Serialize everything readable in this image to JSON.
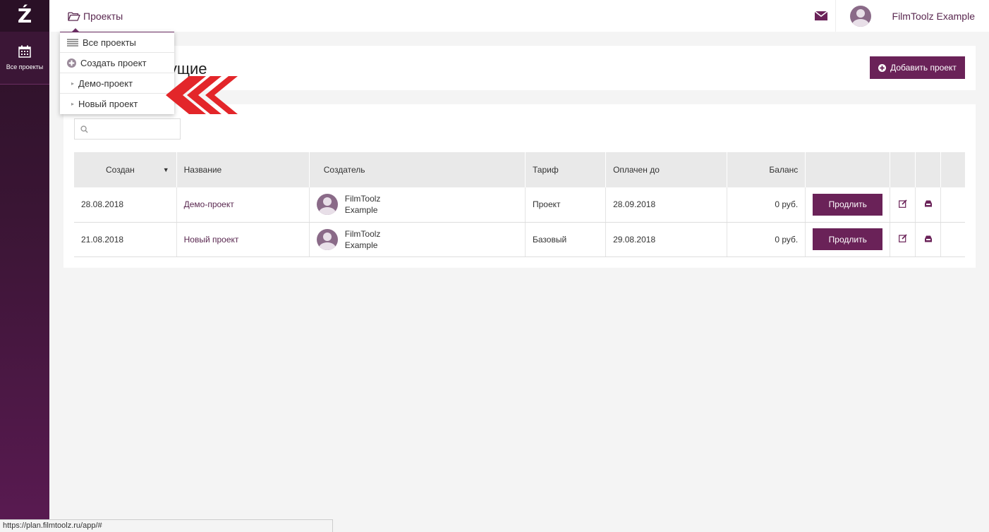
{
  "sidebar": {
    "logo": "Ź",
    "items": [
      {
        "label": "Все проекты",
        "icon": "calendar-icon"
      }
    ]
  },
  "topbar": {
    "projects_label": "Проекты",
    "user_name": "FilmToolz Example"
  },
  "dropdown": {
    "items": [
      {
        "label": "Все проекты",
        "icon": "list-icon"
      },
      {
        "label": "Создать проект",
        "icon": "plus-circle-icon"
      },
      {
        "label": "Демо-проект",
        "icon": "caret-right-icon"
      },
      {
        "label": "Новый проект",
        "icon": "caret-right-icon"
      }
    ]
  },
  "page": {
    "title": "кущие",
    "add_button": "Добавить проект"
  },
  "search": {
    "placeholder": ""
  },
  "table": {
    "headers": [
      "Создан",
      "Название",
      "Создатель",
      "Тариф",
      "Оплачен до",
      "Баланс"
    ],
    "rows": [
      {
        "created": "28.08.2018",
        "name": "Демо-проект",
        "creator_first": "FilmToolz",
        "creator_last": "Example",
        "tariff": "Проект",
        "paid_until": "28.09.2018",
        "balance": "0 руб.",
        "action": "Продлить"
      },
      {
        "created": "21.08.2018",
        "name": "Новый проект",
        "creator_first": "FilmToolz",
        "creator_last": "Example",
        "tariff": "Базовый",
        "paid_until": "29.08.2018",
        "balance": "0 руб.",
        "action": "Продлить"
      }
    ]
  },
  "statusbar": {
    "url": "https://plan.filmtoolz.ru/app/#"
  },
  "colors": {
    "accent": "#6a2258",
    "sidebar": "#3b1636",
    "arrow": "#e3262a"
  }
}
